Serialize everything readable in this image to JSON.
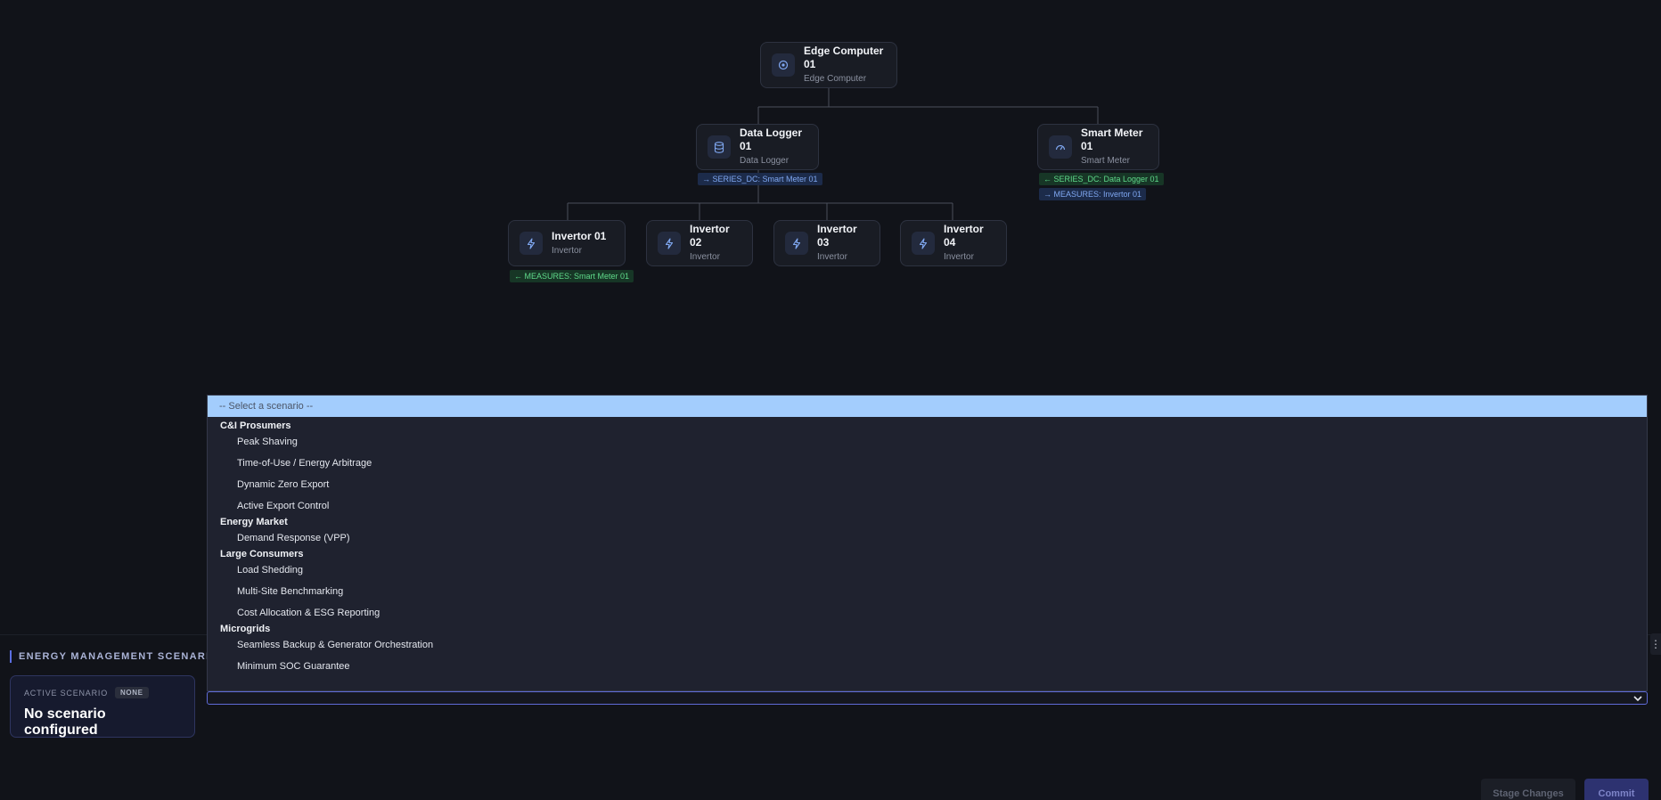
{
  "topology": {
    "nodes": {
      "edge": {
        "name": "Edge Computer 01",
        "type": "Edge Computer",
        "icon": "target-icon"
      },
      "logger": {
        "name": "Data Logger 01",
        "type": "Data Logger",
        "icon": "database-icon"
      },
      "meter": {
        "name": "Smart Meter 01",
        "type": "Smart Meter",
        "icon": "gauge-icon"
      },
      "inv1": {
        "name": "Invertor 01",
        "type": "Invertor",
        "icon": "lightning-icon"
      },
      "inv2": {
        "name": "Invertor 02",
        "type": "Invertor",
        "icon": "lightning-icon"
      },
      "inv3": {
        "name": "Invertor 03",
        "type": "Invertor",
        "icon": "lightning-icon"
      },
      "inv4": {
        "name": "Invertor 04",
        "type": "Invertor",
        "icon": "lightning-icon"
      }
    },
    "tags": {
      "logger_series": "→ SERIES_DC: Smart Meter 01",
      "meter_series": "← SERIES_DC: Data Logger 01",
      "meter_measures": "→ MEASURES: Invertor 01",
      "inv1_measures": "← MEASURES: Smart Meter 01"
    }
  },
  "scenario_panel": {
    "heading": "ENERGY MANAGEMENT SCENARIO",
    "active_label": "ACTIVE SCENARIO",
    "active_badge": "NONE",
    "active_value": "No scenario configured"
  },
  "dropdown": {
    "placeholder": "-- Select a scenario --",
    "groups": [
      {
        "label": "C&I Prosumers",
        "options": [
          "Peak Shaving",
          "Time-of-Use / Energy Arbitrage",
          "Dynamic Zero Export",
          "Active Export Control"
        ]
      },
      {
        "label": "Energy Market",
        "options": [
          "Demand Response (VPP)"
        ]
      },
      {
        "label": "Large Consumers",
        "options": [
          "Load Shedding",
          "Multi-Site Benchmarking",
          "Cost Allocation & ESG Reporting"
        ]
      },
      {
        "label": "Microgrids",
        "options": [
          "Seamless Backup & Generator Orchestration",
          "Minimum SOC Guarantee"
        ]
      }
    ]
  },
  "actions": {
    "stage": "Stage Changes",
    "commit": "Commit"
  },
  "colors": {
    "background": "#111319",
    "accent": "#5b6ee1",
    "highlight": "#a3cdfd",
    "icon": "#7fa7f0"
  }
}
